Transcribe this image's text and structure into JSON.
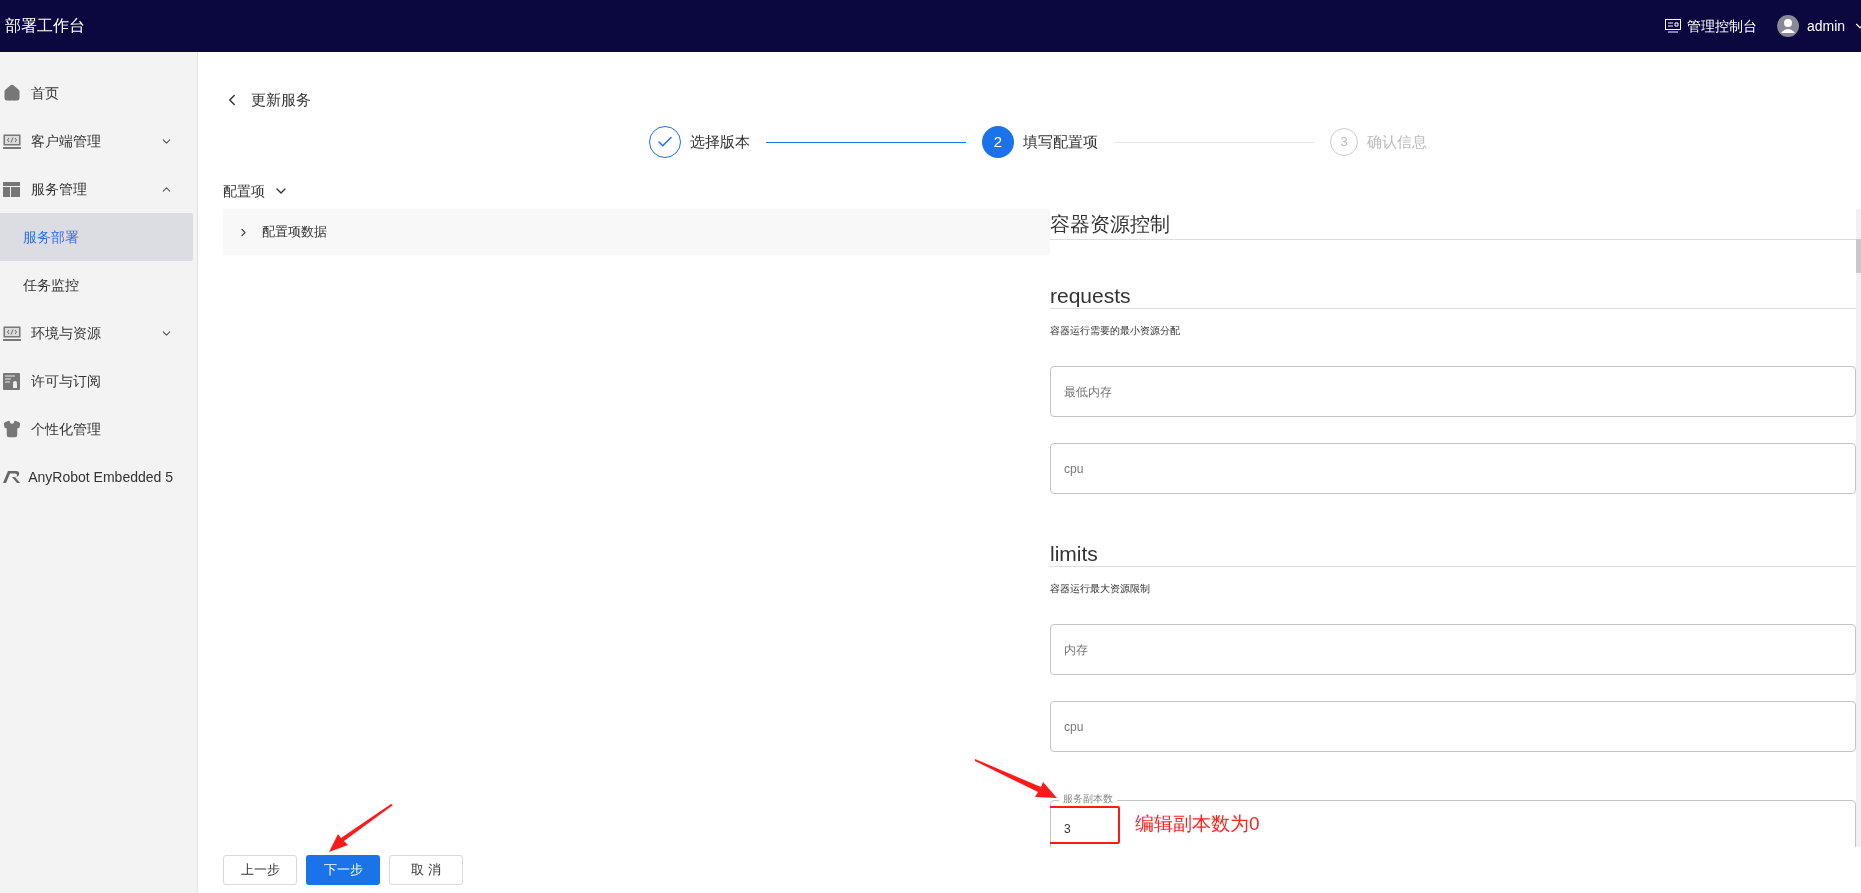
{
  "header": {
    "title": "部署工作台",
    "console": "管理控制台",
    "user": "admin"
  },
  "sidebar": {
    "items": [
      {
        "label": "首页",
        "selected": false
      },
      {
        "label": "客户端管理",
        "selected": false,
        "expanded": false
      },
      {
        "label": "服务管理",
        "selected": false,
        "expanded": true,
        "children": [
          {
            "label": "服务部署",
            "selected": true
          },
          {
            "label": "任务监控",
            "selected": false
          }
        ]
      },
      {
        "label": "环境与资源",
        "selected": false,
        "expanded": false
      },
      {
        "label": "许可与订阅",
        "selected": false
      },
      {
        "label": "个性化管理",
        "selected": false
      },
      {
        "label": "AnyRobot Embedded 5",
        "selected": false
      }
    ]
  },
  "page": {
    "back_title": "更新服务"
  },
  "steps": [
    {
      "label": "选择版本",
      "finished": true,
      "selected": false
    },
    {
      "number": "2",
      "label": "填写配置项",
      "finished": false,
      "selected": true
    },
    {
      "number": "3",
      "label": "确认信息",
      "finished": false,
      "selected": false
    }
  ],
  "config": {
    "label": "配置项",
    "expanded": true,
    "panel": {
      "label": "配置项数据",
      "expanded": false
    }
  },
  "form": {
    "title": "容器资源控制",
    "sections": [
      {
        "heading": "requests",
        "description": "容器运行需要的最小资源分配",
        "fields": [
          {
            "placeholder": "最低内存"
          },
          {
            "placeholder": "cpu"
          }
        ]
      },
      {
        "heading": "limits",
        "description": "容器运行最大资源限制",
        "fields": [
          {
            "placeholder": "内存"
          },
          {
            "placeholder": "cpu"
          }
        ]
      }
    ],
    "replicas": {
      "label": "服务副本数",
      "value": "3"
    }
  },
  "annotation": {
    "text": "编辑副本数为0"
  },
  "buttons": [
    {
      "label": "上一步",
      "primary": false
    },
    {
      "label": "下一步",
      "primary": true
    },
    {
      "label": "取 消",
      "primary": false
    }
  ]
}
